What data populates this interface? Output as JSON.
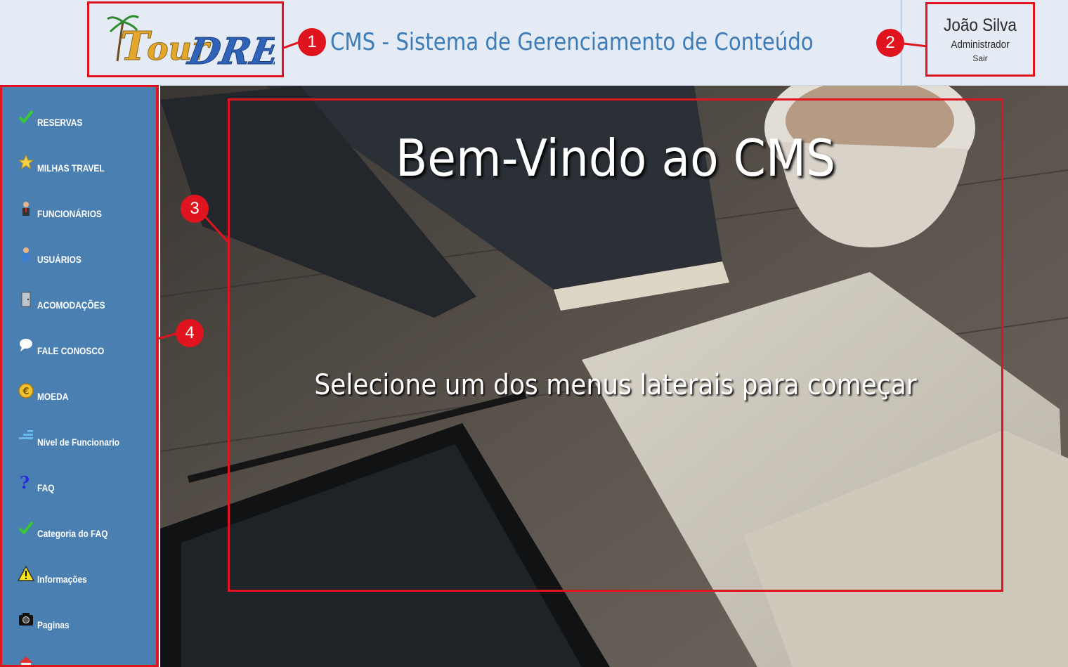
{
  "header": {
    "logo_text": "TourDreams",
    "title": "CMS - Sistema de Gerenciamento de Conteúdo",
    "user": {
      "name": "João Silva",
      "role": "Administrador",
      "logout": "Sair"
    }
  },
  "sidebar": {
    "items": [
      {
        "label": "RESERVAS",
        "icon": "checkmark-icon"
      },
      {
        "label": "MILHAS TRAVEL",
        "icon": "star-icon"
      },
      {
        "label": "FUNCIONÁRIOS",
        "icon": "employee-icon"
      },
      {
        "label": "USUÁRIOS",
        "icon": "user-icon"
      },
      {
        "label": "ACOMODAÇÕES",
        "icon": "door-icon"
      },
      {
        "label": "FALE CONOSCO",
        "icon": "chat-bubble-icon"
      },
      {
        "label": "MOEDA",
        "icon": "euro-coin-icon"
      },
      {
        "label": "Nível de Funcionario",
        "icon": "levels-icon"
      },
      {
        "label": "FAQ",
        "icon": "question-mark-icon"
      },
      {
        "label": "Categoria do FAQ",
        "icon": "checkmark-icon"
      },
      {
        "label": "Informações",
        "icon": "warning-icon"
      },
      {
        "label": "Paginas",
        "icon": "camera-icon"
      }
    ]
  },
  "main": {
    "welcome": "Bem-Vindo ao CMS",
    "subtitle": "Selecione um dos menus laterais para começar"
  },
  "callouts": [
    "1",
    "2",
    "3",
    "4"
  ],
  "colors": {
    "header_bg": "#e4ebf4",
    "title_color": "#3d7cb8",
    "sidebar_bg": "#4a7fb1",
    "annotation_red": "#e0141e"
  }
}
